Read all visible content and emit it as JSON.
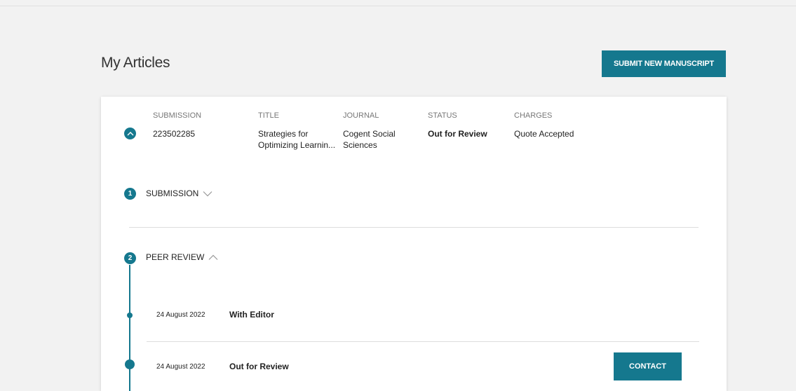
{
  "page": {
    "title": "My Articles",
    "submit_button_label": "SUBMIT NEW MANUSCRIPT"
  },
  "article": {
    "headers": {
      "submission": "SUBMISSION",
      "title": "TITLE",
      "journal": "JOURNAL",
      "status": "STATUS",
      "charges": "CHARGES"
    },
    "submission_id": "223502285",
    "title_line1": "Strategies for",
    "title_line2": "Optimizing Learnin...",
    "journal_line1": "Cogent Social",
    "journal_line2": "Sciences",
    "status": "Out for Review",
    "charges": "Quote Accepted",
    "toggle_icon": "chevron-up-icon"
  },
  "steps": [
    {
      "number": "1",
      "label": "SUBMISSION",
      "expanded": false,
      "icon": "chevron-down-icon"
    },
    {
      "number": "2",
      "label": "PEER REVIEW",
      "expanded": true,
      "icon": "chevron-up-icon"
    }
  ],
  "events": [
    {
      "date": "24 August 2022",
      "status": "With Editor"
    },
    {
      "date": "24 August 2022",
      "status": "Out for Review"
    }
  ],
  "contact_button_label": "CONTACT",
  "colors": {
    "accent": "#15788e",
    "background": "#f2f2f2",
    "card": "#ffffff"
  }
}
